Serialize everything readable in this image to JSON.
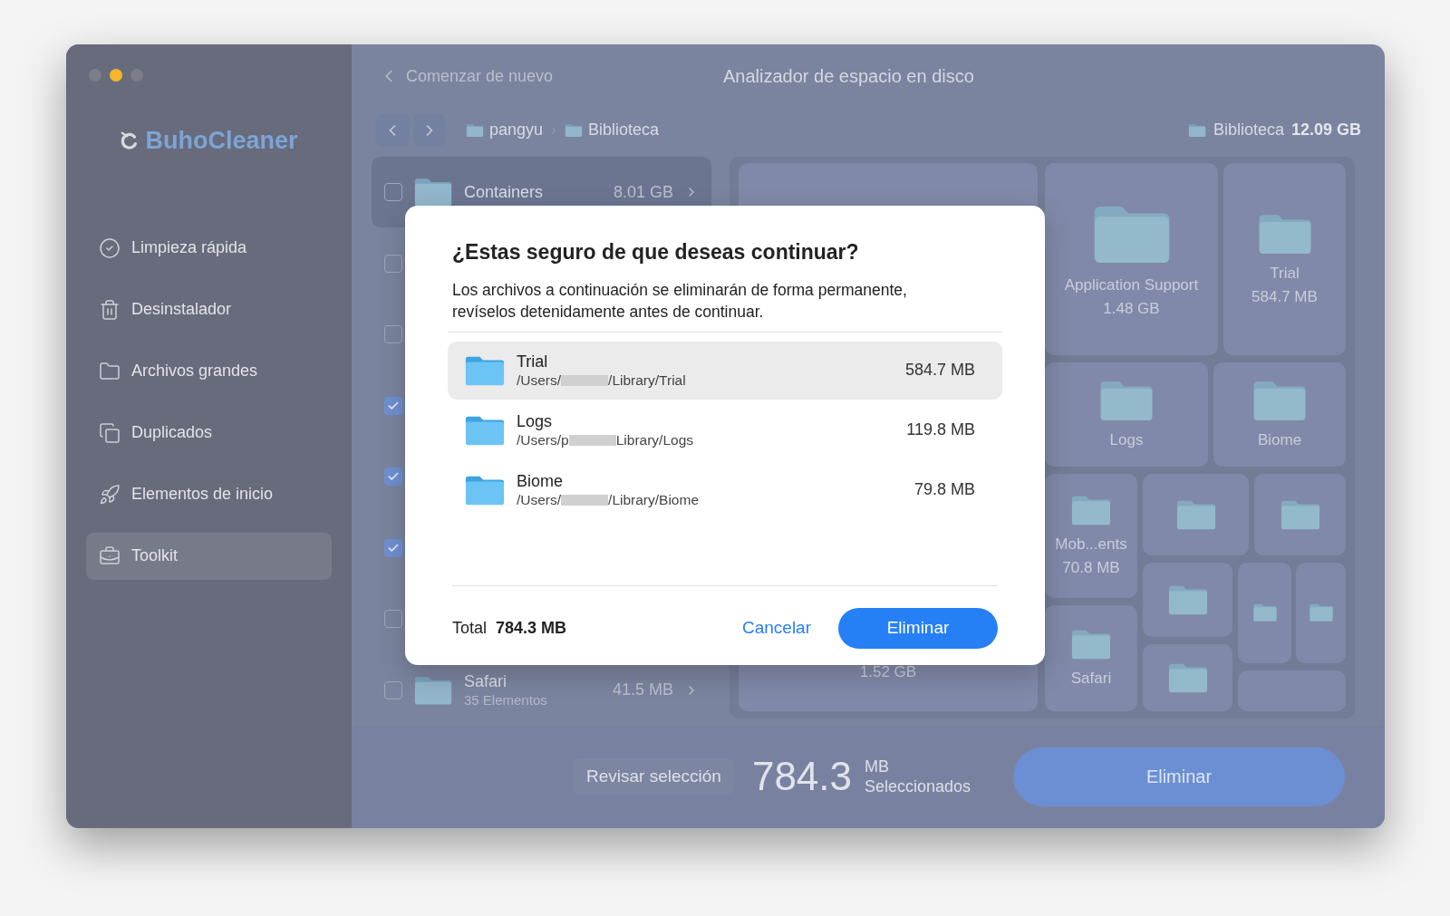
{
  "app": {
    "name": "BuhoCleaner"
  },
  "sidebar": {
    "items": [
      {
        "label": "Limpieza rápida",
        "kind": "quick",
        "selected": false
      },
      {
        "label": "Desinstalador",
        "kind": "trash",
        "selected": false
      },
      {
        "label": "Archivos grandes",
        "kind": "folder",
        "selected": false
      },
      {
        "label": "Duplicados",
        "kind": "copy",
        "selected": false
      },
      {
        "label": "Elementos de inicio",
        "kind": "rocket",
        "selected": false
      },
      {
        "label": "Toolkit",
        "kind": "toolkit",
        "selected": true
      }
    ]
  },
  "header": {
    "back": "Comenzar de nuevo",
    "title": "Analizador de espacio en disco"
  },
  "breadcrumb": [
    "pangyu",
    "Biblioteca"
  ],
  "location": {
    "name": "Biblioteca",
    "size": "12.09 GB"
  },
  "file_list": [
    {
      "name": "Containers",
      "size": "8.01 GB",
      "checked": false,
      "selected": true
    },
    {
      "checked": false,
      "selected": false
    },
    {
      "checked": false,
      "selected": false
    },
    {
      "checked": true,
      "selected": false
    },
    {
      "checked": true,
      "selected": false
    },
    {
      "checked": true,
      "selected": false
    },
    {
      "checked": false,
      "selected": false
    },
    {
      "name": "Safari",
      "count": "35 Elementos",
      "size": "41.5 MB",
      "checked": false,
      "selected": false
    }
  ],
  "treemap": [
    {
      "size": "1.52 GB"
    },
    {
      "name": "Application Support",
      "size": "1.48 GB"
    },
    {
      "name": "Trial",
      "size": "584.7 MB"
    },
    {
      "name": "Logs"
    },
    {
      "name": "Biome"
    },
    {
      "name": "Mob...ents",
      "size": "70.8 MB"
    },
    {
      "kind": "folder"
    },
    {
      "kind": "folder"
    },
    {
      "kind": "folder"
    },
    {
      "kind": "folder"
    },
    {
      "kind": "folder"
    },
    {
      "name": "Safari"
    },
    {
      "kind": "folder"
    },
    {
      "kind": "empty"
    }
  ],
  "bottom_bar": {
    "review": "Revisar selección",
    "amount": "784.3",
    "unit": "MB",
    "caption": "Seleccionados",
    "delete": "Eliminar"
  },
  "dialog": {
    "title": "¿Estas seguro de que deseas continuar?",
    "message": "Los archivos a continuación se eliminarán de forma permanente, revíselos detenidamente antes de continuar.",
    "items": [
      {
        "name": "Trial",
        "path_start": "/Users/",
        "path_end": "/Library/Trial",
        "size": "584.7 MB",
        "selected": true
      },
      {
        "name": "Logs",
        "path_start": "/Users/p",
        "path_end": "Library/Logs",
        "size": "119.8 MB",
        "selected": false
      },
      {
        "name": "Biome",
        "path_start": "/Users/",
        "path_end": "/Library/Biome",
        "size": "79.8 MB",
        "selected": false
      }
    ],
    "total_label": "Total",
    "total": "784.3 MB",
    "cancel": "Cancelar",
    "confirm": "Eliminar"
  }
}
